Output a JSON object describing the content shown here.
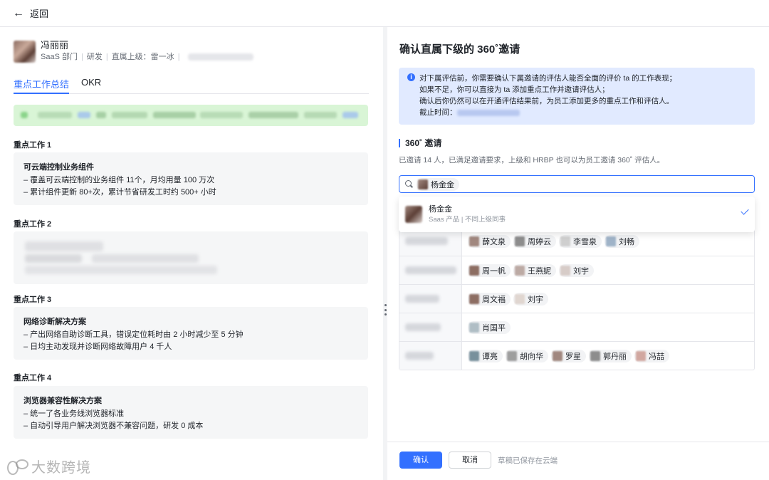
{
  "topbar": {
    "back_label": "返回"
  },
  "profile": {
    "name": "冯丽丽",
    "dept": "SaaS 部门",
    "team": "研发",
    "manager": "直属上级：雷一冰"
  },
  "tabs": [
    {
      "label": "重点工作总结",
      "active": true
    },
    {
      "label": "OKR",
      "active": false
    }
  ],
  "works": [
    {
      "section": "重点工作 1",
      "title": "可云端控制业务组件",
      "lines": [
        "– 覆盖可云端控制的业务组件 11个，月均用量 100 万次",
        "– 累计组件更新 80+次，累计节省研发工时约 500+ 小时"
      ]
    },
    {
      "section": "重点工作 2"
    },
    {
      "section": "重点工作 3",
      "title": "网络诊断解决方案",
      "lines": [
        "– 产出网络自助诊断工具，错误定位耗时由 2 小时减少至 5 分钟",
        "– 日均主动发现并诊断网络故障用户 4 千人"
      ]
    },
    {
      "section": "重点工作 4",
      "title": "浏览器兼容性解决方案",
      "lines": [
        "– 统一了各业务线浏览器标准",
        "– 自动引导用户解决浏览器不兼容问题，研发 0 成本"
      ]
    }
  ],
  "right": {
    "title": "确认直属下级的 360˚邀请",
    "notice": {
      "line1": "对下属评估前，你需要确认下属邀请的评估人能否全面的评价 ta 的工作表现；",
      "line2": "如果不足，你可以直接为 ta 添加重点工作并邀请评估人；",
      "line3": "确认后你仍然可以在开通评估结果前，为员工添加更多的重点工作和评估人。",
      "deadline_label": "截止时间："
    },
    "invite_title": "360˚ 邀请",
    "invite_desc": "已邀请 14 人，已满足邀请要求，上级和 HRBP 也可以为员工邀请 360˚ 评估人。",
    "search_chip": "杨金金",
    "dropdown": {
      "name": "杨金金",
      "sub": "Saas 产品 | 不同上级同事"
    },
    "rows": [
      [
        "薛文泉",
        "周婷云",
        "李雪泉",
        "刘畅"
      ],
      [
        "周一帆",
        "王燕妮",
        "刘宇"
      ],
      [
        "周文福",
        "刘宇"
      ],
      [
        "肖国平"
      ],
      [
        "谭亮",
        "胡向华",
        "罗星",
        "郭丹丽",
        "冯喆"
      ]
    ],
    "confirm_label": "确认",
    "cancel_label": "取消",
    "draft_label": "草稿已保存在云端"
  },
  "watermark": "大数跨境",
  "colors": {
    "accent": "#3370ff",
    "notice_bg": "#e1eaff",
    "success_bg": "#d9f5d6"
  }
}
